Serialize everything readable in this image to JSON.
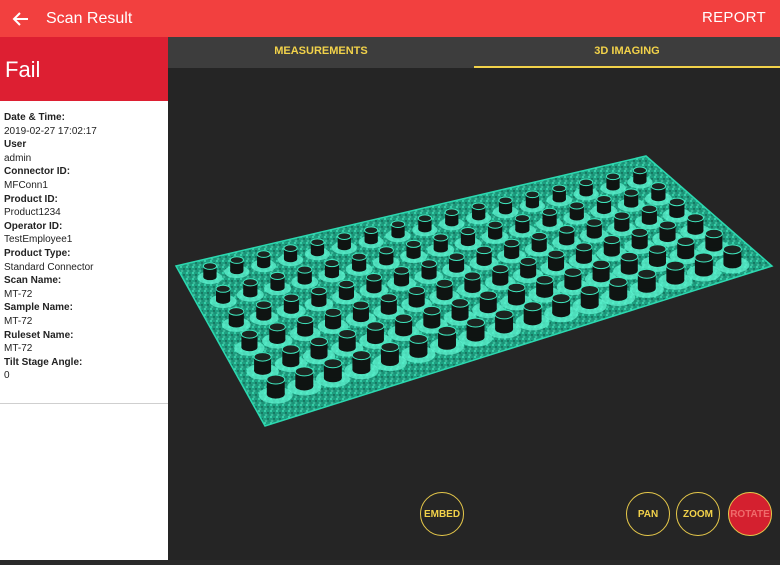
{
  "header": {
    "title": "Scan Result",
    "report_label": "REPORT",
    "back_icon": "arrow-left-icon",
    "color": "#f2403f"
  },
  "status": {
    "label": "Fail",
    "color": "#dd1f32"
  },
  "details": [
    {
      "key": "Date & Time:",
      "value": "2019-02-27 17:02:17"
    },
    {
      "key": "User",
      "value": "admin"
    },
    {
      "key": "Connector ID:",
      "value": "MFConn1"
    },
    {
      "key": "Product ID:",
      "value": "Product1234"
    },
    {
      "key": "Operator ID:",
      "value": "TestEmployee1"
    },
    {
      "key": "Product Type:",
      "value": "Standard Connector"
    },
    {
      "key": "Scan Name:",
      "value": "MT-72"
    },
    {
      "key": "Sample Name:",
      "value": "MT-72"
    },
    {
      "key": "Ruleset Name:",
      "value": "MT-72"
    },
    {
      "key": "Tilt Stage Angle:",
      "value": "0"
    }
  ],
  "tabs": [
    {
      "label": "MEASUREMENTS",
      "active": false
    },
    {
      "label": "3D IMAGING",
      "active": true
    }
  ],
  "controls": {
    "embed": "EMBED",
    "pan": "PAN",
    "zoom": "ZOOM",
    "rotate": "ROTATE",
    "active": "rotate",
    "accent": "#f2d24a"
  },
  "viewer": {
    "surface_color": "#2bd9b0",
    "pin_rows": 6,
    "pin_cols": 17
  }
}
